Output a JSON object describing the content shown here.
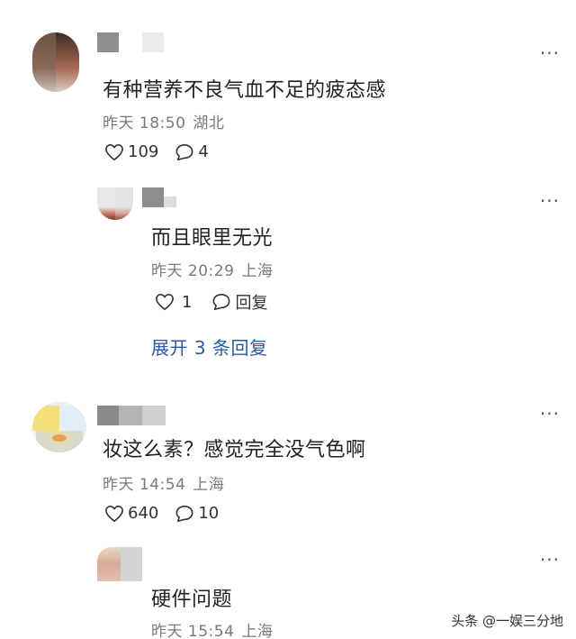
{
  "comments": [
    {
      "text": "有种营养不良气血不足的疲态感",
      "time": "昨天 18:50",
      "location": "湖北",
      "likes": "109",
      "replies": "4",
      "more": "···"
    },
    {
      "text": "而且眼里无光",
      "time": "昨天 20:29",
      "location": "上海",
      "likes": "1",
      "reply_label": "回复",
      "more": "···"
    },
    {
      "text": "妆这么素？感觉完全没气色啊",
      "time": "昨天 14:54",
      "location": "上海",
      "likes": "640",
      "replies": "10",
      "more": "···"
    },
    {
      "text": "硬件问题",
      "time": "昨天 15:54",
      "location": "上海",
      "more": "···"
    }
  ],
  "expand_replies": "展开 3 条回复",
  "watermark": "头条 @一娱三分地",
  "colors": {
    "link": "#2b5a9e",
    "meta": "#7a7a7a"
  }
}
